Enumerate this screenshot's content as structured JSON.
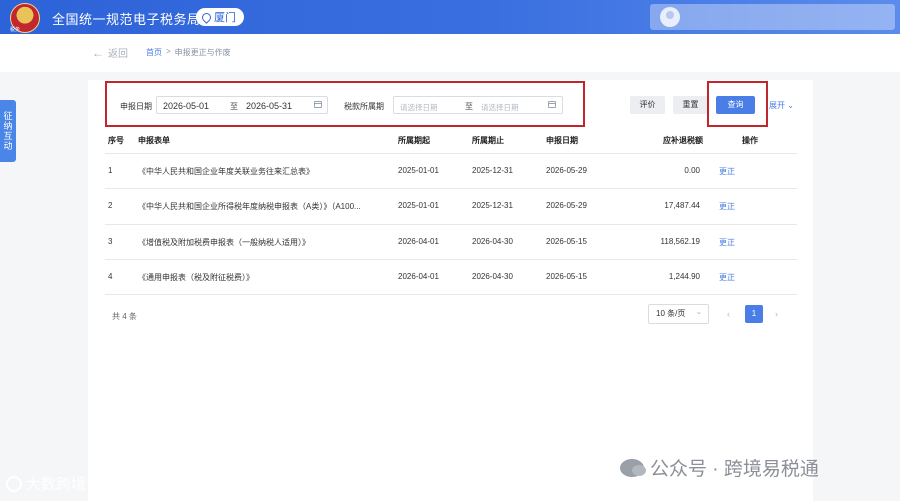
{
  "header": {
    "logo_text": "税务",
    "site_title": "全国统一规范电子税务局",
    "region": "厦门"
  },
  "breadcrumb": {
    "back_label": "返回",
    "home": "首页",
    "separator": ">",
    "current": "申报更正与作废"
  },
  "side_tab": {
    "label": "征纳互动"
  },
  "filters": {
    "declare_date_label": "申报日期",
    "declare_date_start": "2026-05-01",
    "range_separator": "至",
    "declare_date_end": "2026-05-31",
    "tax_period_label": "税款所属期",
    "tax_period_start_placeholder": "请选择日期",
    "tax_period_end_placeholder": "请选择日期"
  },
  "buttons": {
    "evaluate": "评价",
    "reset": "重置",
    "query": "查询",
    "expand": "展开"
  },
  "table": {
    "columns": [
      "序号",
      "申报表单",
      "所属期起",
      "所属期止",
      "申报日期",
      "应补退税额",
      "操作"
    ],
    "rows": [
      {
        "no": "1",
        "form": "《中华人民共和国企业年度关联业务往来汇总表》",
        "start": "2025-01-01",
        "end": "2025-12-31",
        "date": "2026-05-29",
        "amount": "0.00",
        "action": "更正"
      },
      {
        "no": "2",
        "form": "《中华人民共和国企业所得税年度纳税申报表（A类）》（A100...",
        "start": "2025-01-01",
        "end": "2025-12-31",
        "date": "2026-05-29",
        "amount": "17,487.44",
        "action": "更正"
      },
      {
        "no": "3",
        "form": "《增值税及附加税费申报表（一般纳税人适用）》",
        "start": "2026-04-01",
        "end": "2026-04-30",
        "date": "2026-05-15",
        "amount": "118,562.19",
        "action": "更正"
      },
      {
        "no": "4",
        "form": "《通用申报表（税及附征税费）》",
        "start": "2026-04-01",
        "end": "2026-04-30",
        "date": "2026-05-15",
        "amount": "1,244.90",
        "action": "更正"
      }
    ]
  },
  "pagination": {
    "total": "共 4 条",
    "page_size": "10 条/页",
    "current_page": "1",
    "prev": "‹",
    "next": "›"
  },
  "watermarks": {
    "left": "大数跨境",
    "right": "公众号 · 跨境易税通"
  },
  "colors": {
    "primary": "#4a7ee6",
    "header": "#2d63d8",
    "highlight_box": "#c0272d"
  }
}
